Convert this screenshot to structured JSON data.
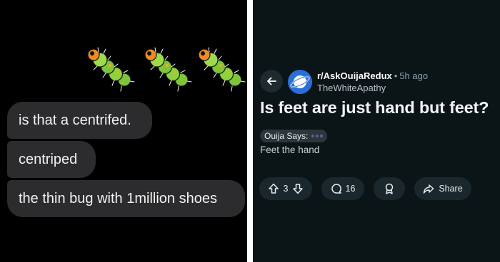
{
  "chat": {
    "emoji": {
      "count": 3,
      "name": "caterpillar-emoji"
    },
    "messages": [
      "is that a centrifed.",
      "centriped",
      "the thin bug with 1million shoes"
    ]
  },
  "reddit": {
    "subreddit": "r/AskOuijaRedux",
    "separator": "•",
    "post_age": "5h ago",
    "username": "TheWhiteApathy",
    "title": "Is feet are just hand but feet?",
    "flair": "Ouija Says:",
    "body": "Feet the hand",
    "actions": {
      "upvotes": "3",
      "comments": "16",
      "share_label": "Share"
    }
  },
  "colors": {
    "chat_background": "#000000",
    "bubble": "#2c2c2e",
    "reddit_background": "#0b1416",
    "action_pill": "#1a282d"
  }
}
